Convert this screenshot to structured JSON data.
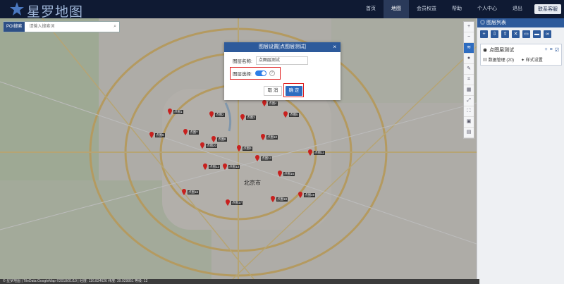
{
  "app": {
    "title": "星罗地图"
  },
  "nav": {
    "items": [
      "首页",
      "地图",
      "会员权益",
      "帮助",
      "个人中心",
      "退出"
    ],
    "active": "地图",
    "contact_label": "联系客服"
  },
  "search": {
    "type_label": "POI搜索",
    "placeholder": "请输入搜索词"
  },
  "panel": {
    "title": "图层列表",
    "layer_name": "点图层测试",
    "data_mgmt_label": "数据管理 (20)",
    "style_label": "样式设置"
  },
  "modal": {
    "title": "图层设置[点图层测试]",
    "name_label": "图层名称:",
    "name_value": "点图层测试",
    "select_label": "图层选择:",
    "toggle_on": true,
    "cancel_label": "取 消",
    "ok_label": "确 定"
  },
  "map": {
    "city_label": "北京市"
  },
  "statusbar": {
    "text": "© 星罗地图 | TileData:GoogleMap ©2018/01/10 | 经度: 116.834626 纬度: 39.929851 等级: 12"
  },
  "pins": [
    "点图1",
    "点图2",
    "点图3",
    "点图4",
    "点图5",
    "点图6",
    "点图7",
    "点图8",
    "点图9",
    "点图10",
    "点图11",
    "点图12",
    "点图13",
    "点图14",
    "点图15",
    "点图16",
    "点图17",
    "点图18",
    "点图19",
    "点图20"
  ],
  "colors": {
    "nav_bg": "#0f1a33",
    "accent": "#2d5a9b",
    "highlight": "#e02020"
  }
}
